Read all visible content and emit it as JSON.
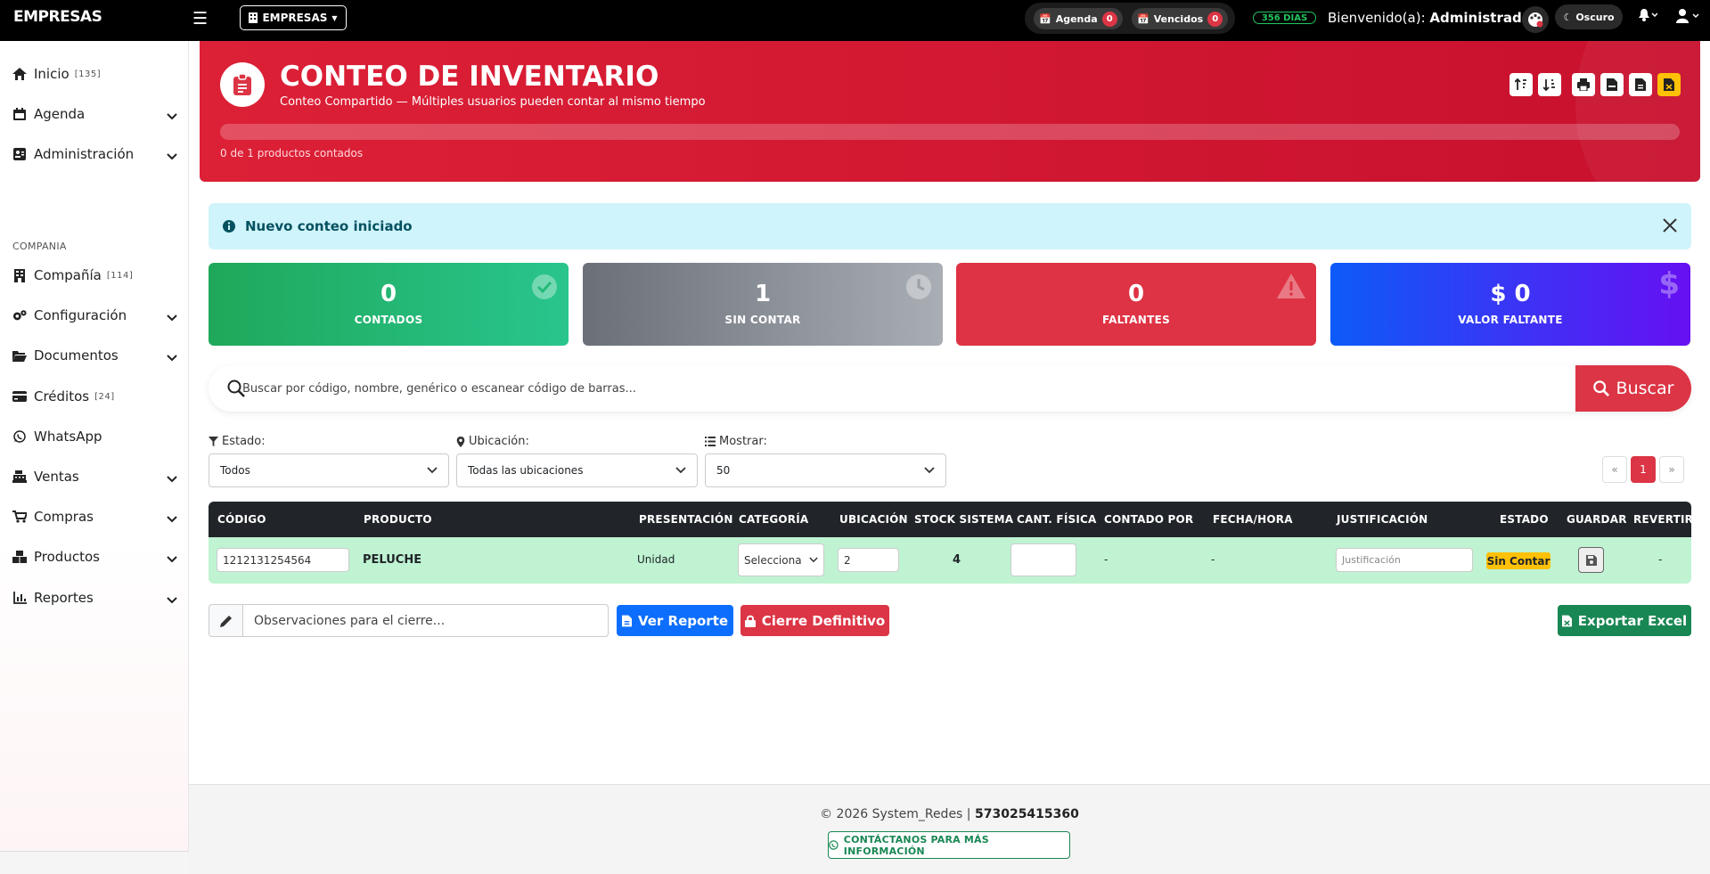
{
  "app": {
    "brand": "EMPRESAS",
    "company_selector": "EMPRESAS"
  },
  "topbar": {
    "agenda_label": "Agenda",
    "agenda_count": "0",
    "vencidos_label": "Vencidos",
    "vencidos_count": "0",
    "days_badge": "356 DIAS",
    "welcome_prefix": "Bienvenido(a):",
    "welcome_user": "Administrador",
    "theme_label": "Oscuro"
  },
  "sidebar": {
    "items": [
      {
        "label": "Inicio",
        "badge": "[135]"
      },
      {
        "label": "Agenda"
      },
      {
        "label": "Administración"
      },
      {
        "label": "Compañía",
        "badge": "[114]"
      },
      {
        "label": "Configuración"
      },
      {
        "label": "Documentos"
      },
      {
        "label": "Créditos",
        "badge": "[24]"
      },
      {
        "label": "WhatsApp"
      },
      {
        "label": "Ventas"
      },
      {
        "label": "Compras"
      },
      {
        "label": "Productos"
      },
      {
        "label": "Reportes"
      }
    ],
    "section_label": "COMPANIA"
  },
  "header": {
    "title": "CONTEO DE INVENTARIO",
    "subtitle": "Conteo Compartido — Múltiples usuarios pueden contar al mismo tiempo",
    "progress_fraction": 0,
    "progress_text": "0 de 1 productos contados"
  },
  "alert": {
    "text": "Nuevo conteo iniciado"
  },
  "stats": [
    {
      "value": "0",
      "label": "CONTADOS"
    },
    {
      "value": "1",
      "label": "SIN CONTAR"
    },
    {
      "value": "0",
      "label": "FALTANTES"
    },
    {
      "value": "$ 0",
      "label": "VALOR FALTANTE"
    }
  ],
  "search": {
    "placeholder": "Buscar por código, nombre, genérico o escanear código de barras...",
    "button": "Buscar"
  },
  "filters": {
    "estado_label": "Estado:",
    "estado_value": "Todos",
    "ubicacion_label": "Ubicación:",
    "ubicacion_value": "Todas las ubicaciones",
    "mostrar_label": "Mostrar:",
    "mostrar_value": "50"
  },
  "pagination": {
    "prev": "«",
    "current": "1",
    "next": "»"
  },
  "table": {
    "headers": [
      "CÓDIGO",
      "PRODUCTO",
      "PRESENTACIÓN",
      "CATEGORÍA",
      "UBICACIÓN",
      "STOCK SISTEMA",
      "CANT. FÍSICA",
      "CONTADO POR",
      "FECHA/HORA",
      "JUSTIFICACIÓN",
      "ESTADO",
      "GUARDAR",
      "REVERTIR"
    ],
    "rows": [
      {
        "codigo": "1212131254564",
        "producto": "PELUCHE",
        "presentacion": "Unidad",
        "categoria": "Selecciona",
        "ubicacion": "2",
        "stock": "4",
        "cant_fisica": "",
        "contado_por": "-",
        "fecha": "-",
        "justificacion_placeholder": "Justificación",
        "estado": "Sin Contar",
        "revertir": "-"
      }
    ]
  },
  "actions": {
    "obs_placeholder": "Observaciones para el cierre...",
    "ver_reporte": "Ver Reporte",
    "cierre": "Cierre Definitivo",
    "exportar": "Exportar Excel"
  },
  "footer": {
    "copyright": "© 2026 System_Redes |",
    "phone": "573025415360",
    "contact": "CONTÁCTANOS PARA MÁS INFORMACIÓN"
  },
  "colors": {
    "accent": "#dc3545",
    "header_bg": "#c8102e",
    "row_bg": "#bff3d2"
  }
}
